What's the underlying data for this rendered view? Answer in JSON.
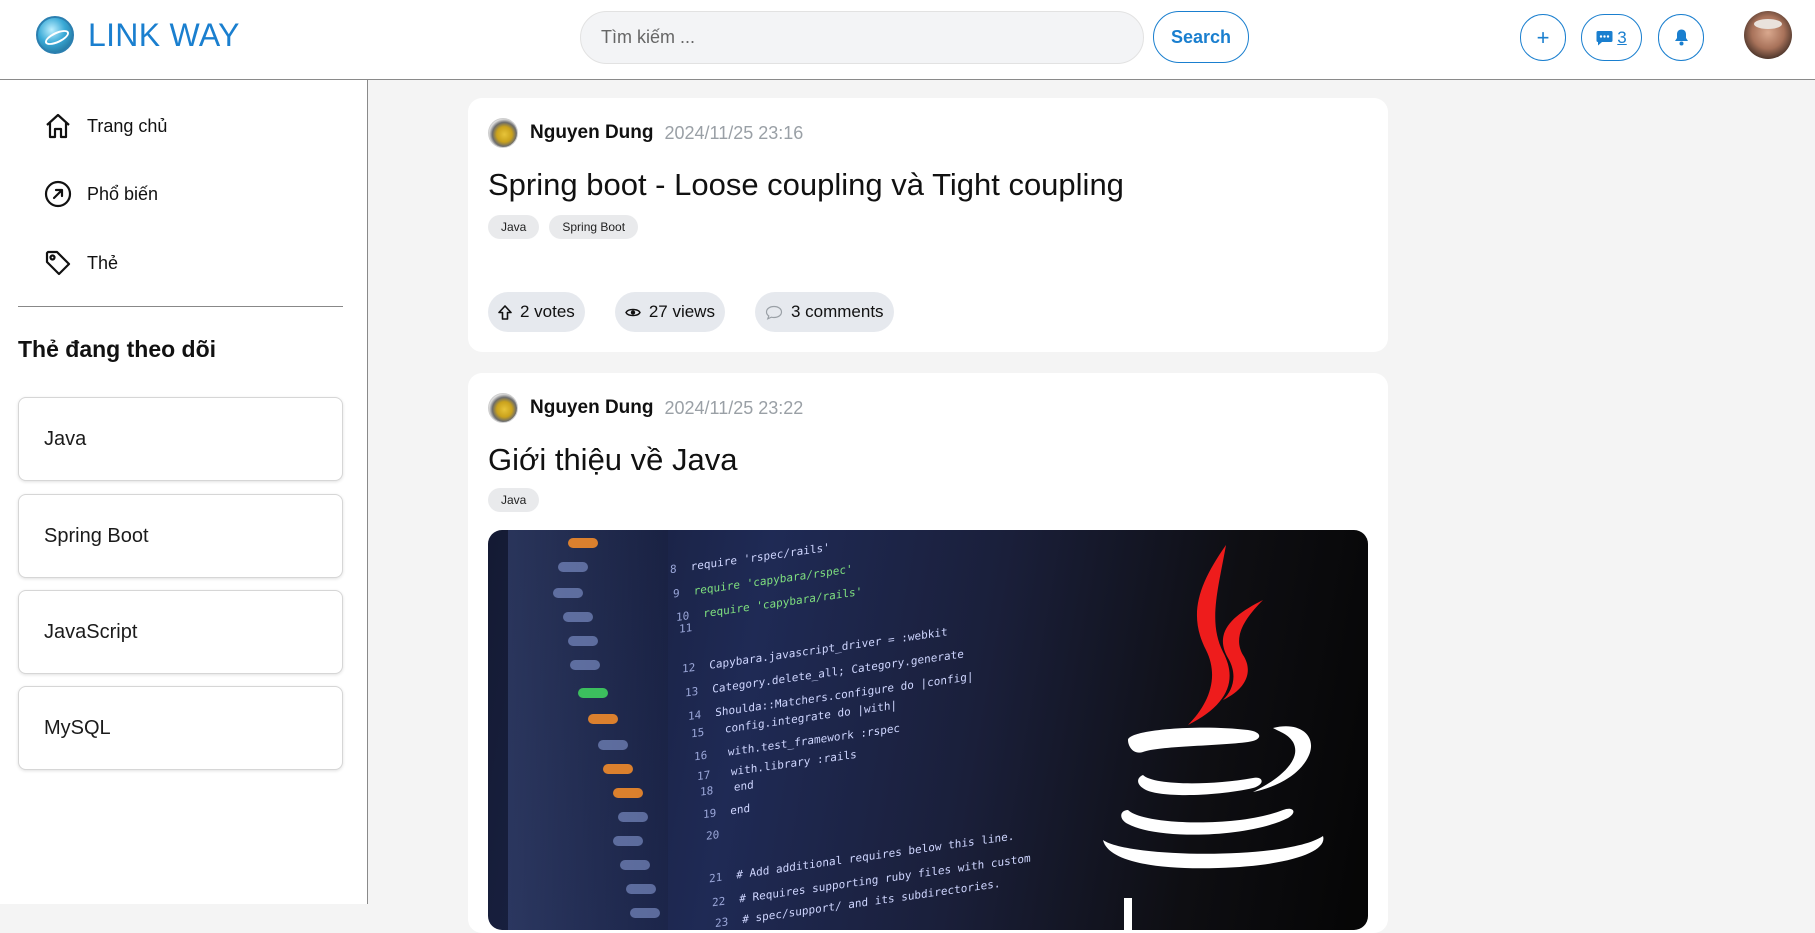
{
  "header": {
    "logo_text": "LINK WAY",
    "search_placeholder": "Tìm kiếm ...",
    "search_button": "Search",
    "add_button": "+",
    "messages_count": "3",
    "accent_color": "#1a7fcf"
  },
  "sidebar": {
    "nav": [
      {
        "label": "Trang chủ",
        "icon": "home-icon"
      },
      {
        "label": "Phổ biến",
        "icon": "trending-icon"
      },
      {
        "label": "Thẻ",
        "icon": "tag-icon"
      }
    ],
    "follow_title": "Thẻ đang theo dõi",
    "followed_tags": [
      "Java",
      "Spring Boot",
      "JavaScript",
      "MySQL"
    ]
  },
  "posts": [
    {
      "author": "Nguyen Dung",
      "time": "2024/11/25 23:16",
      "title": "Spring boot - Loose coupling và Tight coupling",
      "tags": [
        "Java",
        "Spring Boot"
      ],
      "votes": "2 votes",
      "views": "27 views",
      "comments": "3 comments"
    },
    {
      "author": "Nguyen Dung",
      "time": "2024/11/25 23:22",
      "title": "Giới thiệu về Java",
      "tags": [
        "Java"
      ],
      "image": "java-code-cover-image"
    }
  ],
  "image_code": [
    {
      "n": "8",
      "t": "require 'rspec/rails'"
    },
    {
      "n": "9",
      "t": "require 'capybara/rspec'"
    },
    {
      "n": "10",
      "t": "require 'capybara/rails'"
    },
    {
      "n": "11",
      "t": ""
    },
    {
      "n": "12",
      "t": "Capybara.javascript_driver = :webkit"
    },
    {
      "n": "13",
      "t": "Category.delete_all; Category.generate"
    },
    {
      "n": "14",
      "t": "Shoulda::Matchers.configure do |config|"
    },
    {
      "n": "15",
      "t": "  config.integrate do |with|"
    },
    {
      "n": "16",
      "t": "    with.test_framework :rspec"
    },
    {
      "n": "17",
      "t": "    with.library :rails"
    },
    {
      "n": "18",
      "t": "  end"
    },
    {
      "n": "19",
      "t": "end"
    },
    {
      "n": "20",
      "t": ""
    },
    {
      "n": "21",
      "t": "# Add additional requires below this line."
    },
    {
      "n": "22",
      "t": "# Requires supporting ruby files with custom"
    },
    {
      "n": "23",
      "t": "# spec/support/ and its subdirectories."
    }
  ]
}
